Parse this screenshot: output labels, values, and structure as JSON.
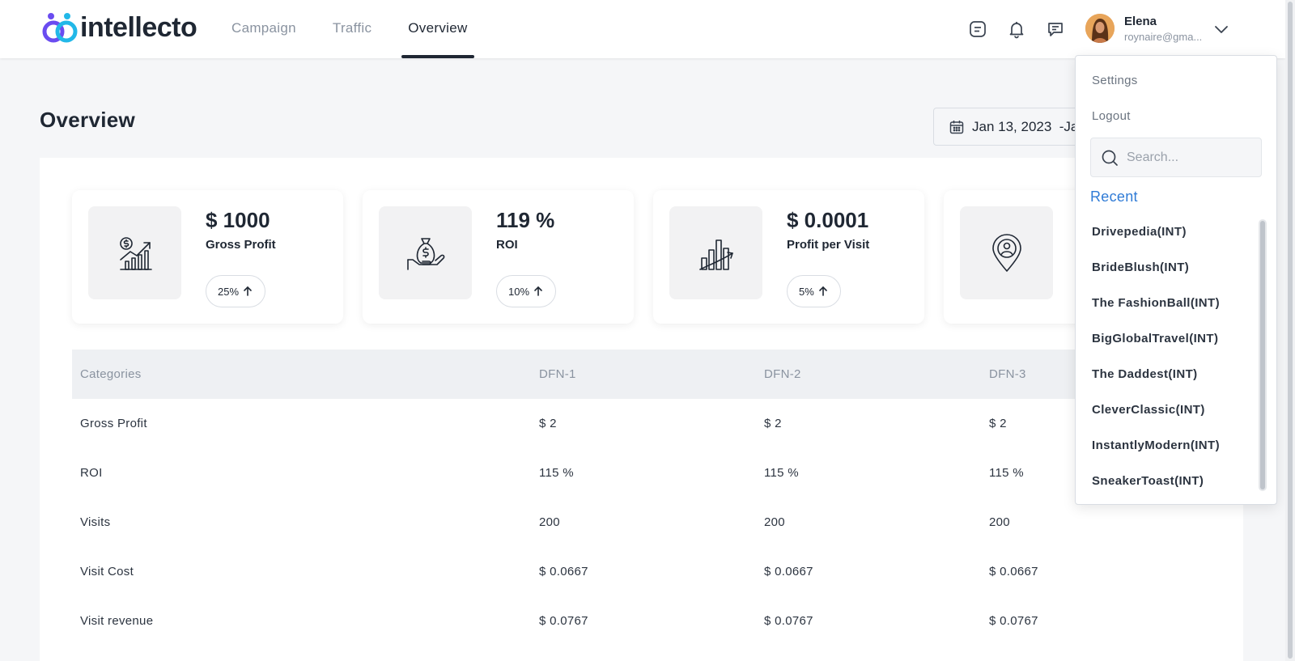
{
  "header": {
    "logo_text": "intellecto",
    "nav": [
      {
        "label": "Campaign"
      },
      {
        "label": "Traffic"
      },
      {
        "label": "Overview"
      }
    ],
    "user": {
      "name": "Elena",
      "email": "roynaire@gma..."
    }
  },
  "page": {
    "title": "Overview",
    "date_range": "Jan 13, 2023  -Ja"
  },
  "cards": [
    {
      "value": "$ 1000",
      "label": "Gross Profit",
      "badge": "25%",
      "icon": "money-growth-chart-icon"
    },
    {
      "value": "119 %",
      "label": "ROI",
      "badge": "10%",
      "icon": "money-bag-hand-icon"
    },
    {
      "value": "$ 0.0001",
      "label": "Profit per Visit",
      "badge": "5%",
      "icon": "bar-chart-trend-icon"
    },
    {
      "value": "",
      "label": "",
      "badge": "",
      "icon": "location-user-pin-icon"
    }
  ],
  "table": {
    "headers": [
      "Categories",
      "DFN-1",
      "DFN-2",
      "DFN-3"
    ],
    "rows": [
      [
        "Gross Profit",
        "$ 2",
        "$ 2",
        "$ 2"
      ],
      [
        "ROI",
        "115 %",
        "115 %",
        "115 %"
      ],
      [
        "Visits",
        "200",
        "200",
        "200"
      ],
      [
        "Visit Cost",
        "$ 0.0667",
        "$ 0.0667",
        "$ 0.0667"
      ],
      [
        "Visit revenue",
        "$ 0.0767",
        "$ 0.0767",
        "$ 0.0767"
      ]
    ]
  },
  "dropdown": {
    "settings": "Settings",
    "logout": "Logout",
    "search_placeholder": "Search...",
    "recent_label": "Recent",
    "recent_items": [
      "Drivepedia(INT)",
      "BrideBlush(INT)",
      "The FashionBall(INT)",
      "BigGlobalTravel(INT)",
      "The Daddest(INT)",
      "CleverClassic(INT)",
      "InstantlyModern(INT)",
      "SneakerToast(INT)"
    ]
  },
  "colors": {
    "primary_text": "#1f2733",
    "muted_text": "#8a93a0",
    "accent_blue": "#2f7bd6",
    "logo_purple": "#6a4cf0",
    "logo_cyan": "#22b8e8"
  }
}
